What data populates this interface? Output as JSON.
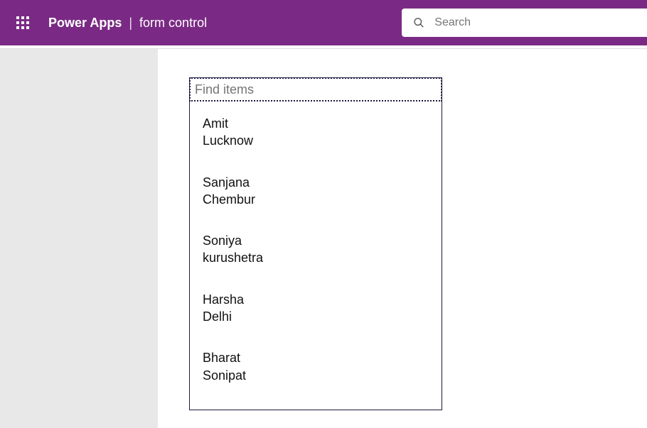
{
  "header": {
    "product": "Power Apps",
    "separator": "|",
    "page": "form control",
    "search_placeholder": "Search"
  },
  "gallery": {
    "find_placeholder": "Find items",
    "items": [
      {
        "name": "Amit",
        "city": "Lucknow"
      },
      {
        "name": "Sanjana",
        "city": "Chembur"
      },
      {
        "name": "Soniya",
        "city": "kurushetra"
      },
      {
        "name": "Harsha",
        "city": "Delhi"
      },
      {
        "name": "Bharat",
        "city": "Sonipat"
      }
    ]
  }
}
